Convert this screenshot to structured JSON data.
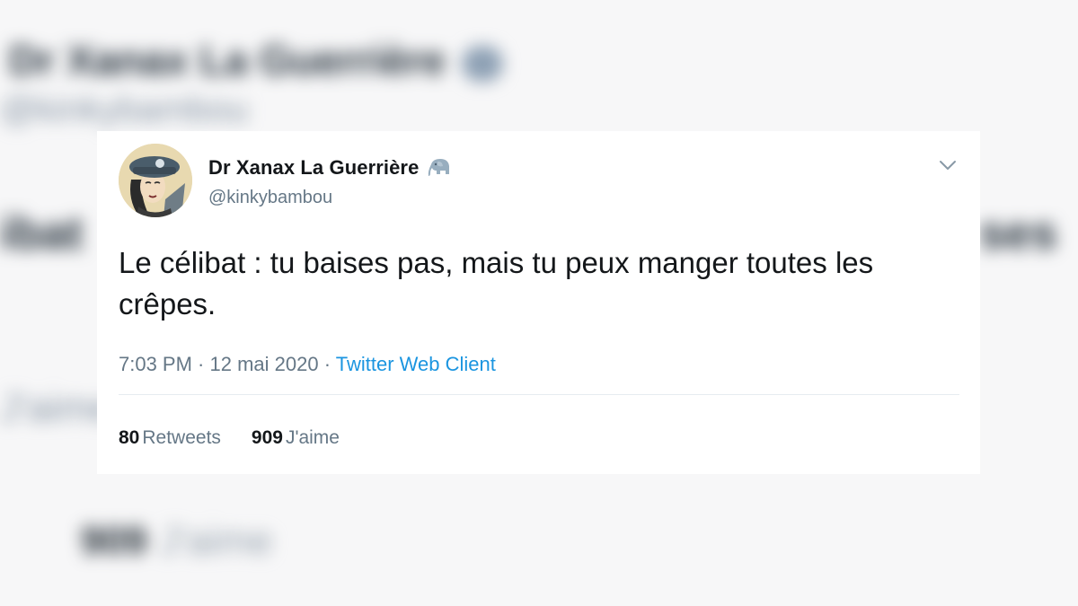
{
  "background": {
    "name": "Dr Xanax La Guerrière",
    "handle": "@kinkybambou",
    "text_left": "ibat",
    "text_right": "ses",
    "stat_label": "J'aime",
    "likes_count": "909"
  },
  "tweet": {
    "display_name": "Dr Xanax La Guerrière",
    "name_icon": "elephant-icon",
    "handle": "@kinkybambou",
    "text": "Le célibat : tu baises pas, mais tu peux manger toutes les crêpes.",
    "time": "7:03 PM",
    "separator_1": " · ",
    "date": "12 mai 2020",
    "separator_2": " · ",
    "client": "Twitter Web Client",
    "retweets_count": "80",
    "retweets_label": "Retweets",
    "likes_count": "909",
    "likes_label": "J'aime"
  },
  "colors": {
    "link": "#1b95e0",
    "secondary_text": "#657786",
    "primary_text": "#14171a"
  }
}
